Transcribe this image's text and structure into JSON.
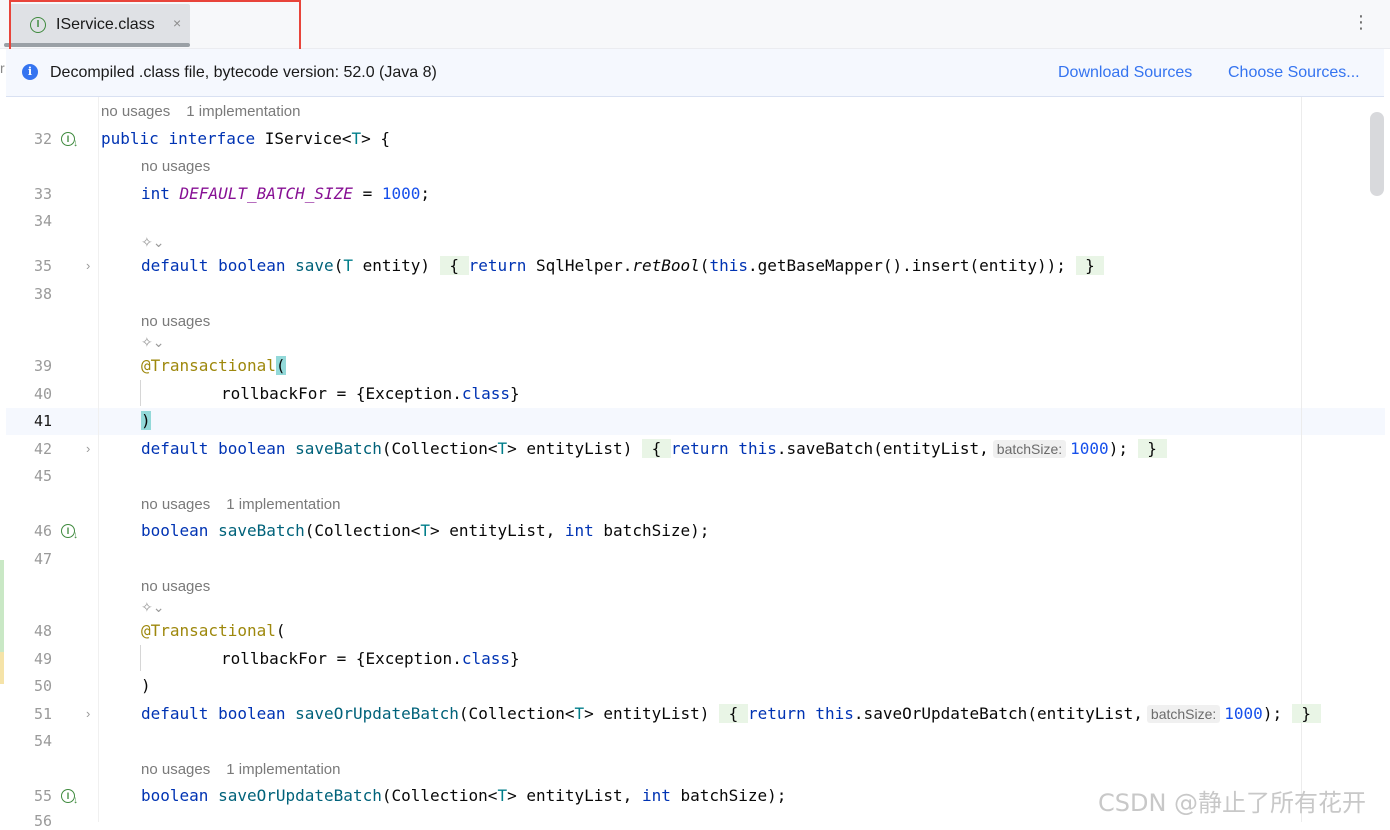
{
  "tab": {
    "icon_letter": "I",
    "label": "IService.class",
    "close": "×"
  },
  "menu_glyph": "⋮",
  "banner": {
    "text": "Decompiled .class file, bytecode version: 52.0 (Java 8)",
    "download_sources": "Download Sources",
    "choose_sources": "Choose Sources..."
  },
  "left_edge_char": "r",
  "hints": {
    "no_usages": "no usages",
    "one_impl": "1 implementation"
  },
  "ai_icon_glyph": "✧⌄",
  "gutter_icon_letter": "I",
  "fold_glyph": "›",
  "lines": {
    "l32": "32",
    "l33": "33",
    "l34": "34",
    "l35": "35",
    "l38": "38",
    "l39": "39",
    "l40": "40",
    "l41": "41",
    "l42": "42",
    "l45": "45",
    "l46": "46",
    "l47": "47",
    "l48": "48",
    "l49": "49",
    "l50": "50",
    "l51": "51",
    "l54": "54",
    "l55": "55",
    "l56": "56"
  },
  "code": {
    "c32": {
      "kw1": "public",
      "kw2": "interface",
      "name": "IService<",
      "tp": "T",
      "end": "> {"
    },
    "c33": {
      "kw": "int",
      "const": "DEFAULT_BATCH_SIZE",
      "eq": " = ",
      "num": "1000",
      "end": ";"
    },
    "c35": {
      "kw1": "default",
      "kw2": "boolean",
      "fn": "save",
      "p1": "(",
      "tp": "T",
      "p2": " entity)",
      "ob": "{",
      "ret": "return",
      "helper": " SqlHelper.",
      "rb": "retBool",
      "p3": "(",
      "th": "this",
      "rest": ".getBaseMapper().insert(entity));",
      "cb": "}"
    },
    "c39": {
      "ann": "@Transactional",
      "open": "("
    },
    "c40": {
      "a": "rollbackFor = {Exception.",
      "kw": "class",
      "b": "}"
    },
    "c41": {
      "close": ")"
    },
    "c42": {
      "kw1": "default",
      "kw2": "boolean",
      "fn": "saveBatch",
      "p1": "(Collection<",
      "tp": "T",
      "p2": "> entityList)",
      "ob": "{",
      "ret": "return",
      "th": "this",
      "rest": ".saveBatch(entityList,",
      "inlay": "batchSize:",
      "num": "1000",
      "end": ");",
      "cb": "}"
    },
    "c46": {
      "kw": "boolean",
      "fn": "saveBatch",
      "p1": "(Collection<",
      "tp": "T",
      "p2": "> entityList, ",
      "kw2": "int",
      "p3": " batchSize);"
    },
    "c48": {
      "ann": "@Transactional",
      "open": "("
    },
    "c49": {
      "a": "rollbackFor = {Exception.",
      "kw": "class",
      "b": "}"
    },
    "c50": {
      "close": ")"
    },
    "c51": {
      "kw1": "default",
      "kw2": "boolean",
      "fn": "saveOrUpdateBatch",
      "p1": "(Collection<",
      "tp": "T",
      "p2": "> entityList)",
      "ob": "{",
      "ret": "return",
      "th": "this",
      "rest": ".saveOrUpdateBatch(entityList,",
      "inlay": "batchSize:",
      "num": "1000",
      "end": ");",
      "cb": "}"
    },
    "c55": {
      "kw": "boolean",
      "fn": "saveOrUpdateBatch",
      "p1": "(Collection<",
      "tp": "T",
      "p2": "> entityList, ",
      "kw2": "int",
      "p3": " batchSize);"
    }
  },
  "watermark": "CSDN @静止了所有花开",
  "colors": {
    "keyword": "#0033b3",
    "type_param": "#007e8a",
    "function": "#00627a",
    "constant": "#871094",
    "number": "#1750eb",
    "annotation": "#9e880d",
    "link": "#3574f0",
    "highlight_box": "#e8443a"
  }
}
